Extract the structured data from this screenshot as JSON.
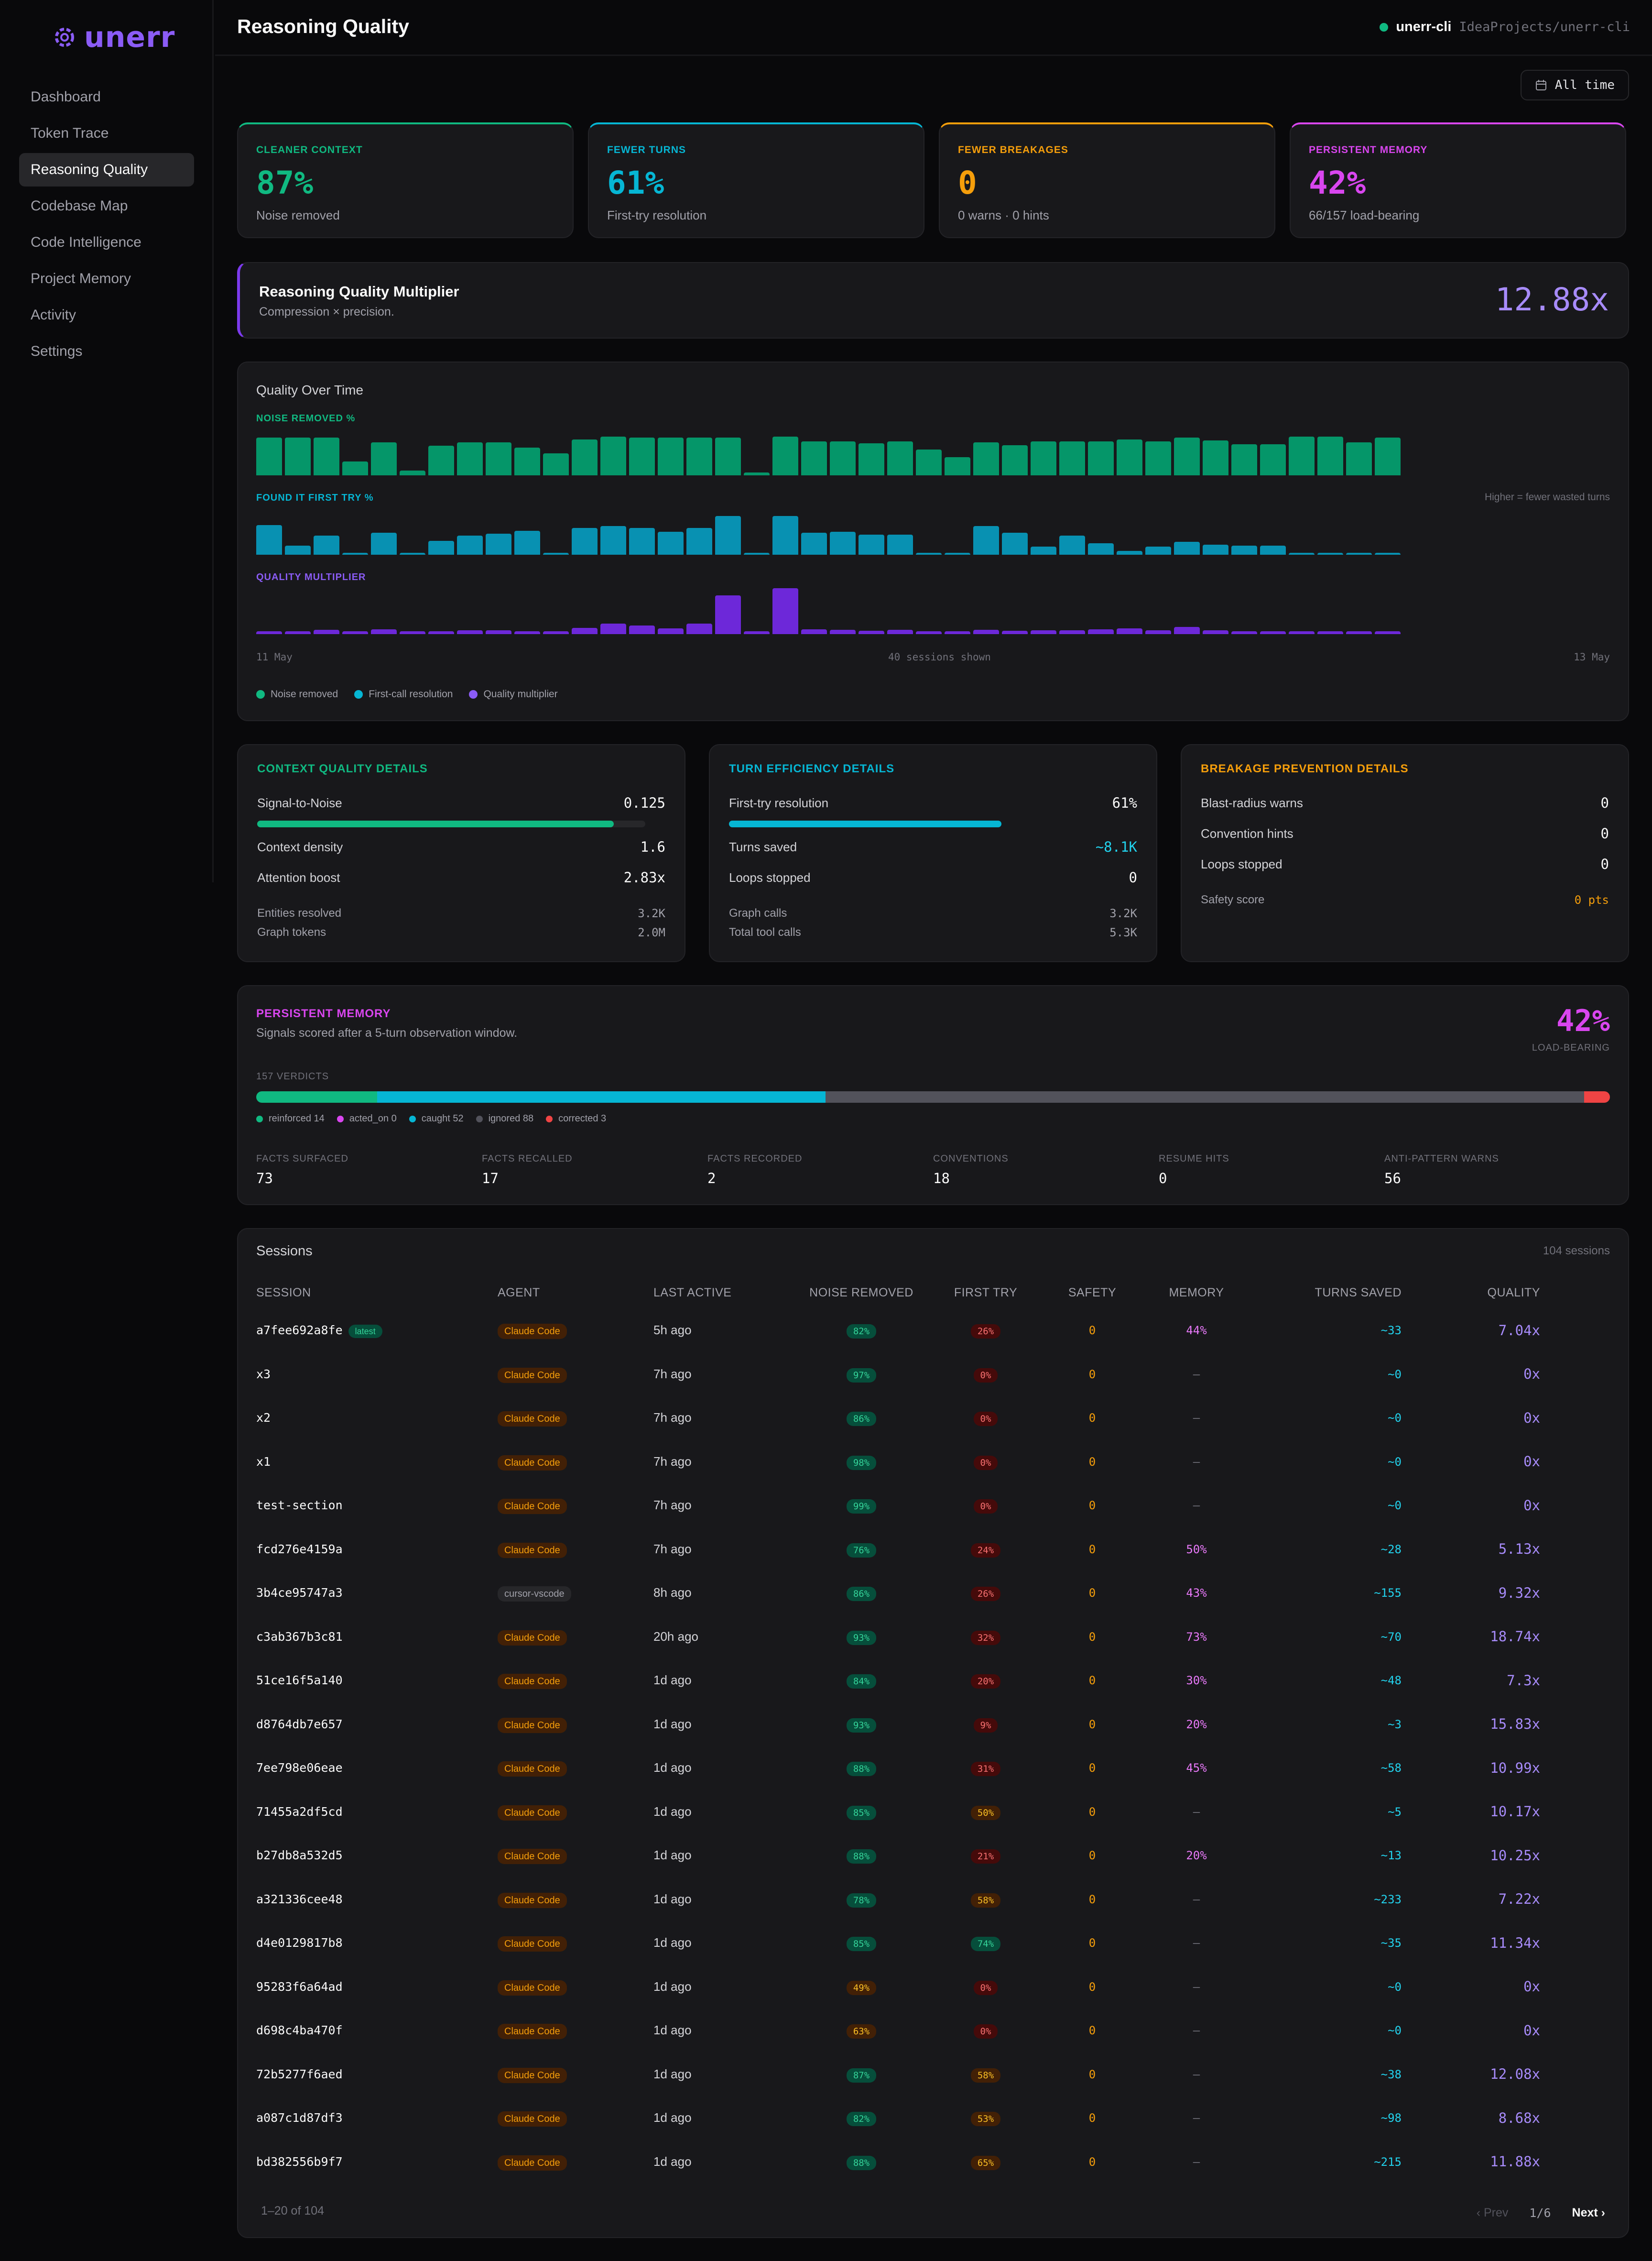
{
  "app": {
    "name": "unerr"
  },
  "nav": [
    {
      "label": "Dashboard",
      "name": "nav-dashboard"
    },
    {
      "label": "Token Trace",
      "name": "nav-token-trace"
    },
    {
      "label": "Reasoning Quality",
      "name": "nav-reasoning-quality",
      "active": true
    },
    {
      "label": "Codebase Map",
      "name": "nav-codebase-map"
    },
    {
      "label": "Code Intelligence",
      "name": "nav-code-intelligence"
    },
    {
      "label": "Project Memory",
      "name": "nav-project-memory"
    },
    {
      "label": "Activity",
      "name": "nav-activity"
    },
    {
      "label": "Settings",
      "name": "nav-settings"
    }
  ],
  "header": {
    "title": "Reasoning Quality",
    "project_name": "unerr-cli",
    "project_path": "IdeaProjects/unerr-cli"
  },
  "range": {
    "label": "All time"
  },
  "kpis": [
    {
      "label": "CLEANER CONTEXT",
      "value": "87%",
      "sub": "Noise removed",
      "color": "#10b981"
    },
    {
      "label": "FEWER TURNS",
      "value": "61%",
      "sub": "First-try resolution",
      "color": "#06b6d4"
    },
    {
      "label": "FEWER BREAKAGES",
      "value": "0",
      "sub": "0 warns · 0 hints",
      "color": "#f59e0b"
    },
    {
      "label": "PERSISTENT MEMORY",
      "value": "42%",
      "sub": "66/157 load-bearing",
      "color": "#d946ef"
    }
  ],
  "multiplier": {
    "title": "Reasoning Quality Multiplier",
    "sub": "Compression × precision.",
    "value": "12.88x"
  },
  "quality_chart": {
    "title": "Quality Over Time",
    "hint": "Higher = fewer wasted turns",
    "x_start": "11 May",
    "x_mid": "40 sessions shown",
    "x_end": "13 May",
    "legend": [
      "Noise removed",
      "First-call resolution",
      "Quality multiplier"
    ]
  },
  "chart_data": {
    "type": "bar",
    "series": [
      {
        "name": "NOISE REMOVED %",
        "color": "#059669",
        "values": [
          82,
          82,
          82,
          30,
          72,
          10,
          65,
          72,
          72,
          60,
          48,
          78,
          84,
          82,
          82,
          82,
          82,
          6,
          84,
          74,
          74,
          70,
          74,
          56,
          40,
          72,
          66,
          74,
          74,
          74,
          78,
          74,
          82,
          76,
          68,
          68,
          84,
          84,
          72,
          82
        ]
      },
      {
        "name": "FOUND IT FIRST TRY %",
        "color": "#0891b2",
        "values": [
          65,
          20,
          42,
          0,
          48,
          0,
          30,
          42,
          46,
          52,
          0,
          58,
          62,
          58,
          50,
          58,
          84,
          0,
          84,
          48,
          50,
          44,
          44,
          0,
          0,
          62,
          48,
          18,
          42,
          25,
          8,
          18,
          28,
          22,
          20,
          20,
          2,
          2,
          2,
          2
        ]
      },
      {
        "name": "QUALITY MULTIPLIER",
        "color": "#6d28d9",
        "values": [
          1.5,
          1.5,
          2.5,
          1.5,
          2.8,
          1.5,
          1.5,
          2.2,
          2.2,
          1.5,
          1.5,
          3.5,
          6,
          5,
          3.2,
          6,
          22,
          1.5,
          26,
          2.8,
          2.5,
          2,
          2.5,
          1.5,
          1.5,
          2.5,
          2,
          2.2,
          2.2,
          2.6,
          3.2,
          2.2,
          4,
          2.2,
          1.5,
          1.5,
          1.5,
          1.5,
          1.5,
          1.5
        ]
      }
    ],
    "x_range": [
      "11 May",
      "13 May"
    ],
    "legend_placement": "bottom-left",
    "grid": false
  },
  "details": {
    "context": {
      "title": "CONTEXT QUALITY DETAILS",
      "rows": [
        [
          "Signal-to-Noise",
          "0.125"
        ],
        [
          "Context density",
          "1.6"
        ],
        [
          "Attention boost",
          "2.83x"
        ]
      ],
      "small": [
        [
          "Entities resolved",
          "3.2K"
        ],
        [
          "Graph tokens",
          "2.0M"
        ]
      ],
      "bar_fraction": 0.87
    },
    "turn": {
      "title": "TURN EFFICIENCY DETAILS",
      "rows": [
        [
          "First-try resolution",
          "61%"
        ],
        [
          "Turns saved",
          "~8.1K"
        ],
        [
          "Loops stopped",
          "0"
        ]
      ],
      "small": [
        [
          "Graph calls",
          "3.2K"
        ],
        [
          "Total tool calls",
          "5.3K"
        ]
      ],
      "bar_fraction": 0.61
    },
    "breakage": {
      "title": "BREAKAGE PREVENTION DETAILS",
      "rows": [
        [
          "Blast-radius warns",
          "0"
        ],
        [
          "Convention hints",
          "0"
        ],
        [
          "Loops stopped",
          "0"
        ]
      ],
      "small": [
        [
          "Safety score",
          "0 pts"
        ]
      ]
    }
  },
  "memory": {
    "title": "PERSISTENT MEMORY",
    "sub": "Signals scored after a 5-turn observation window.",
    "value": "42%",
    "value_sub": "LOAD-BEARING",
    "verdicts": "157 VERDICTS",
    "segments": [
      {
        "label": "reinforced 14",
        "count": 14,
        "color": "#10b981"
      },
      {
        "label": "acted_on 0",
        "count": 0,
        "color": "#d946ef"
      },
      {
        "label": "caught 52",
        "count": 52,
        "color": "#06b6d4"
      },
      {
        "label": "ignored 88",
        "count": 88,
        "color": "#52525b"
      },
      {
        "label": "corrected 3",
        "count": 3,
        "color": "#ef4444"
      }
    ],
    "stats": [
      {
        "label": "FACTS SURFACED",
        "value": "73"
      },
      {
        "label": "FACTS RECALLED",
        "value": "17"
      },
      {
        "label": "FACTS RECORDED",
        "value": "2"
      },
      {
        "label": "CONVENTIONS",
        "value": "18"
      },
      {
        "label": "RESUME HITS",
        "value": "0"
      },
      {
        "label": "ANTI-PATTERN WARNS",
        "value": "56"
      }
    ]
  },
  "sessions": {
    "title": "Sessions",
    "count": "104 sessions",
    "latest_badge": "latest",
    "columns": [
      "SESSION",
      "AGENT",
      "LAST ACTIVE",
      "NOISE REMOVED",
      "FIRST TRY",
      "SAFETY",
      "MEMORY",
      "TURNS SAVED",
      "QUALITY"
    ],
    "rows": [
      [
        "a7fee692a8fe",
        "Claude Code",
        "5h ago",
        "82%",
        "26%",
        "0",
        "44%",
        "~33",
        "7.04x"
      ],
      [
        "x3",
        "Claude Code",
        "7h ago",
        "97%",
        "0%",
        "0",
        "—",
        "~0",
        "0x"
      ],
      [
        "x2",
        "Claude Code",
        "7h ago",
        "86%",
        "0%",
        "0",
        "—",
        "~0",
        "0x"
      ],
      [
        "x1",
        "Claude Code",
        "7h ago",
        "98%",
        "0%",
        "0",
        "—",
        "~0",
        "0x"
      ],
      [
        "test-section",
        "Claude Code",
        "7h ago",
        "99%",
        "0%",
        "0",
        "—",
        "~0",
        "0x"
      ],
      [
        "fcd276e4159a",
        "Claude Code",
        "7h ago",
        "76%",
        "24%",
        "0",
        "50%",
        "~28",
        "5.13x"
      ],
      [
        "3b4ce95747a3",
        "cursor-vscode",
        "8h ago",
        "86%",
        "26%",
        "0",
        "43%",
        "~155",
        "9.32x"
      ],
      [
        "c3ab367b3c81",
        "Claude Code",
        "20h ago",
        "93%",
        "32%",
        "0",
        "73%",
        "~70",
        "18.74x"
      ],
      [
        "51ce16f5a140",
        "Claude Code",
        "1d ago",
        "84%",
        "20%",
        "0",
        "30%",
        "~48",
        "7.3x"
      ],
      [
        "d8764db7e657",
        "Claude Code",
        "1d ago",
        "93%",
        "9%",
        "0",
        "20%",
        "~3",
        "15.83x"
      ],
      [
        "7ee798e06eae",
        "Claude Code",
        "1d ago",
        "88%",
        "31%",
        "0",
        "45%",
        "~58",
        "10.99x"
      ],
      [
        "71455a2df5cd",
        "Claude Code",
        "1d ago",
        "85%",
        "50%",
        "0",
        "—",
        "~5",
        "10.17x"
      ],
      [
        "b27db8a532d5",
        "Claude Code",
        "1d ago",
        "88%",
        "21%",
        "0",
        "20%",
        "~13",
        "10.25x"
      ],
      [
        "a321336cee48",
        "Claude Code",
        "1d ago",
        "78%",
        "58%",
        "0",
        "—",
        "~233",
        "7.22x"
      ],
      [
        "d4e0129817b8",
        "Claude Code",
        "1d ago",
        "85%",
        "74%",
        "0",
        "—",
        "~35",
        "11.34x"
      ],
      [
        "95283f6a64ad",
        "Claude Code",
        "1d ago",
        "49%",
        "0%",
        "0",
        "—",
        "~0",
        "0x"
      ],
      [
        "d698c4ba470f",
        "Claude Code",
        "1d ago",
        "63%",
        "0%",
        "0",
        "—",
        "~0",
        "0x"
      ],
      [
        "72b5277f6aed",
        "Claude Code",
        "1d ago",
        "87%",
        "58%",
        "0",
        "—",
        "~38",
        "12.08x"
      ],
      [
        "a087c1d87df3",
        "Claude Code",
        "1d ago",
        "82%",
        "53%",
        "0",
        "—",
        "~98",
        "8.68x"
      ],
      [
        "bd382556b9f7",
        "Claude Code",
        "1d ago",
        "88%",
        "65%",
        "0",
        "—",
        "~215",
        "11.88x"
      ]
    ],
    "pager_label": "1–20 of 104",
    "prev": "‹ Prev",
    "page": "1/6",
    "next": "Next ›"
  }
}
